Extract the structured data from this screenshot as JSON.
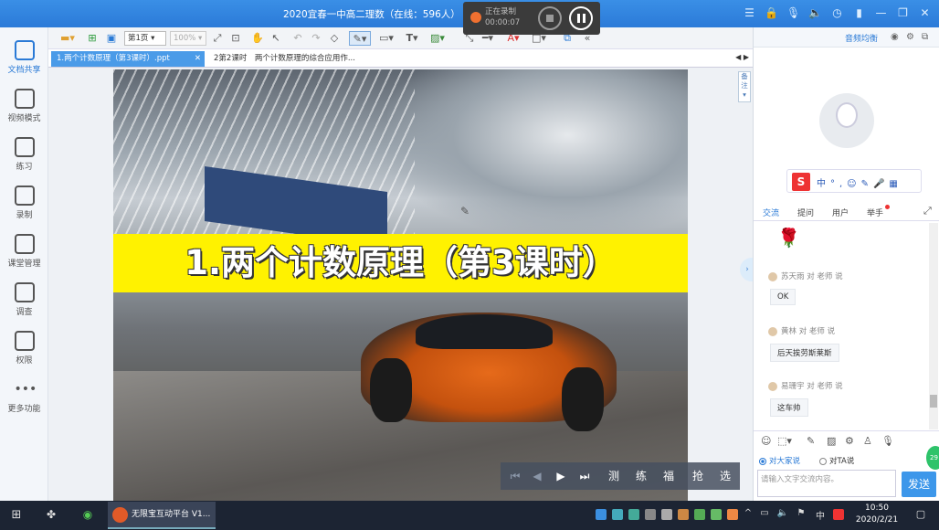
{
  "window": {
    "title": "2020宜春一中高二理数（在线：596人）"
  },
  "recording": {
    "status": "正在录制",
    "time": "00:00:07"
  },
  "sidebar": {
    "items": [
      {
        "label": "文档共享",
        "icon": "document-icon",
        "active": true
      },
      {
        "label": "视频模式",
        "icon": "video-mode-icon",
        "active": false
      },
      {
        "label": "练习",
        "icon": "exercise-icon",
        "active": false
      },
      {
        "label": "录制",
        "icon": "record-icon",
        "active": false
      },
      {
        "label": "课堂管理",
        "icon": "class-manage-icon",
        "active": false
      },
      {
        "label": "调查",
        "icon": "survey-icon",
        "active": false
      },
      {
        "label": "权限",
        "icon": "permission-icon",
        "active": false
      },
      {
        "label": "更多功能",
        "icon": "more-icon",
        "active": false
      }
    ]
  },
  "toolbar": {
    "page": "第1页",
    "zoom": "100%"
  },
  "doc_tabs": [
    {
      "label": "1.两个计数原理（第3课时）.ppt",
      "active": true
    },
    {
      "label": "2第2课时　两个计数原理的综合应用作..."
    }
  ],
  "slide": {
    "title": "1.两个计数原理（第3课时）"
  },
  "note_button": "备注",
  "playbar": {
    "labels": [
      "测",
      "练",
      "福",
      "抢",
      "选"
    ]
  },
  "right_panel": {
    "audio_label": "音频均衡",
    "chat_tabs": [
      "交流",
      "提问",
      "用户",
      "举手"
    ],
    "messages": [
      {
        "sender": "苏天雨 对 老师 说",
        "text": "OK"
      },
      {
        "sender": "黄林 对 老师 说",
        "text": "后天挨劳斯莱斯"
      },
      {
        "sender": "易珊宇 对 老师 说",
        "text": "这车帅"
      }
    ],
    "radio_all": "对大家说",
    "radio_ta": "对TA说",
    "input_placeholder": "请输入文字交流内容。",
    "send_label": "发送",
    "float_label": "29"
  },
  "taskbar": {
    "app_label": "无限宝互动平台 V1...",
    "time": "10:50",
    "date": "2020/2/21",
    "ime": "中"
  },
  "colors": {
    "accent": "#2a7ad6",
    "titlebar": "#2b7ad8",
    "banner": "#fff200"
  }
}
